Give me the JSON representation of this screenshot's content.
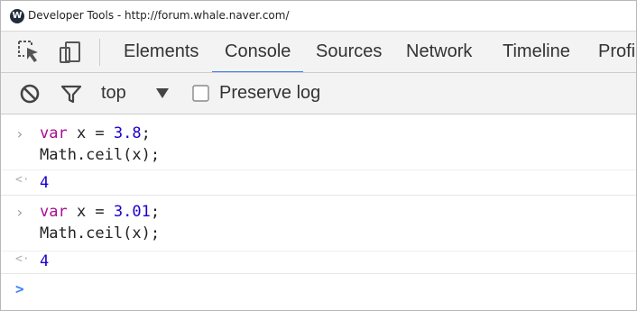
{
  "window": {
    "title": "Developer Tools - http://forum.whale.naver.com/",
    "logo_letter": "W"
  },
  "tabs": [
    {
      "label": "Elements",
      "selected": false
    },
    {
      "label": "Console",
      "selected": true
    },
    {
      "label": "Sources",
      "selected": false
    },
    {
      "label": "Network",
      "selected": false
    },
    {
      "label": "Timeline",
      "selected": false
    },
    {
      "label": "Profi",
      "selected": false
    }
  ],
  "toolbar": {
    "icons": [
      "inspect-element-icon",
      "device-mode-icon",
      "clear-console-icon",
      "filter-icon",
      "dropdown-arrow-icon"
    ],
    "context": "top",
    "preserve_log_label": "Preserve log",
    "preserve_log_checked": false
  },
  "console": {
    "entries": [
      {
        "input": {
          "line1": {
            "keyword": "var",
            "rest": " x = ",
            "number": "3.8",
            "end": ";"
          },
          "line2": "Math.ceil(x);"
        },
        "output": "4"
      },
      {
        "input": {
          "line1": {
            "keyword": "var",
            "rest": " x = ",
            "number": "3.01",
            "end": ";"
          },
          "line2": "Math.ceil(x);"
        },
        "output": "4"
      }
    ],
    "prompt_symbol": ">"
  },
  "colors": {
    "keyword": "#aa0d91",
    "number": "#1c00cf",
    "tab_underline": "#3e82f7",
    "prompt": "#3e82f7"
  }
}
